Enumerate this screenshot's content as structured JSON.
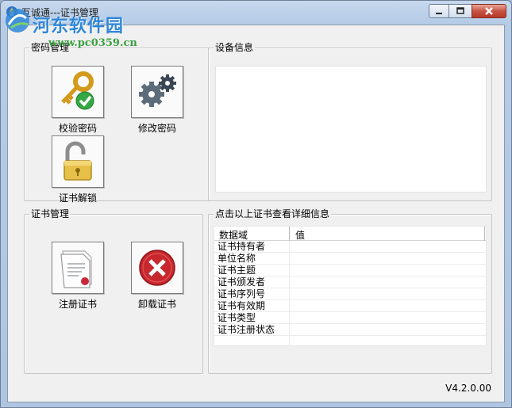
{
  "window": {
    "title": "互诚通---证书管理",
    "version": "V4.2.0.00"
  },
  "watermark": {
    "title": "河东软件园",
    "url": "www.pc0359.cn"
  },
  "password_group": {
    "title": "密码管理",
    "verify_label": "校验密码",
    "change_label": "修改密码",
    "unlock_label": "证书解锁"
  },
  "device_group": {
    "title": "设备信息"
  },
  "cert_group": {
    "title": "证书管理",
    "register_label": "注册证书",
    "uninstall_label": "卸载证书"
  },
  "detail_group": {
    "title": "点击以上证书查看详细信息",
    "columns": [
      "数据域",
      "值"
    ],
    "rows": [
      {
        "field": "证书持有者",
        "value": ""
      },
      {
        "field": "单位名称",
        "value": ""
      },
      {
        "field": "证书主题",
        "value": ""
      },
      {
        "field": "证书颁发者",
        "value": ""
      },
      {
        "field": "证书序列号",
        "value": ""
      },
      {
        "field": "证书有效期",
        "value": ""
      },
      {
        "field": "证书类型",
        "value": ""
      },
      {
        "field": "证书注册状态",
        "value": ""
      }
    ]
  },
  "colors": {
    "titlebar": "#b5cbe6",
    "close_button": "#c75444",
    "panel": "#f0f0f0",
    "watermark_blue": "#2f86d8",
    "watermark_green": "#3aa040"
  },
  "icons": {
    "verify": "key-check-icon",
    "change": "gears-icon",
    "unlock": "padlock-open-icon",
    "register": "certificate-icon",
    "uninstall": "red-x-icon"
  }
}
